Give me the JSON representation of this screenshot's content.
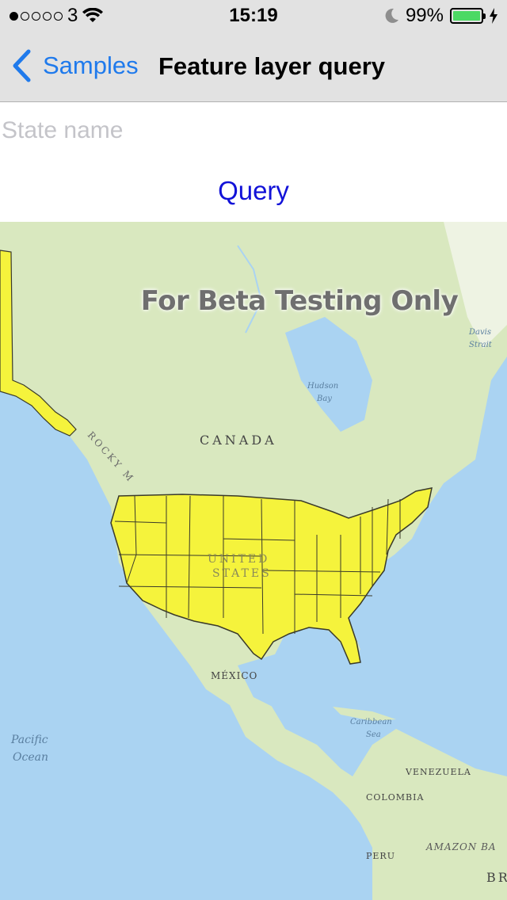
{
  "status_bar": {
    "carrier": "3",
    "signal_level": "1 of 5",
    "time": "15:19",
    "battery": "99%",
    "battery_level": 0.99,
    "icons": [
      "wifi-icon",
      "moon-icon",
      "battery-icon",
      "charging-bolt-icon"
    ]
  },
  "nav": {
    "back_label": "Samples",
    "title": "Feature layer query"
  },
  "search": {
    "placeholder": "State name",
    "value": ""
  },
  "query_button": "Query",
  "map": {
    "watermark": "For Beta Testing Only",
    "labels": {
      "canada": "CANADA",
      "united_states_1": "UNITED",
      "united_states_2": "STATES",
      "mexico": "MÉXICO",
      "pacific_1": "Pacific",
      "pacific_2": "Ocean",
      "hudson_1": "Hudson",
      "hudson_2": "Bay",
      "davis_1": "Davis",
      "davis_2": "Strait",
      "caribbean_1": "Caribbean",
      "caribbean_2": "Sea",
      "venezuela": "VENEZUELA",
      "colombia": "COLOMBIA",
      "peru": "PERU",
      "amazon": "AMAZON BA",
      "rocky": "ROCKY M",
      "brazil": "BR"
    },
    "colors": {
      "ocean": "#aad3f2",
      "land": "#d9e8bf",
      "highlight": "#f5f33c",
      "outline": "#3a3a2a"
    }
  }
}
